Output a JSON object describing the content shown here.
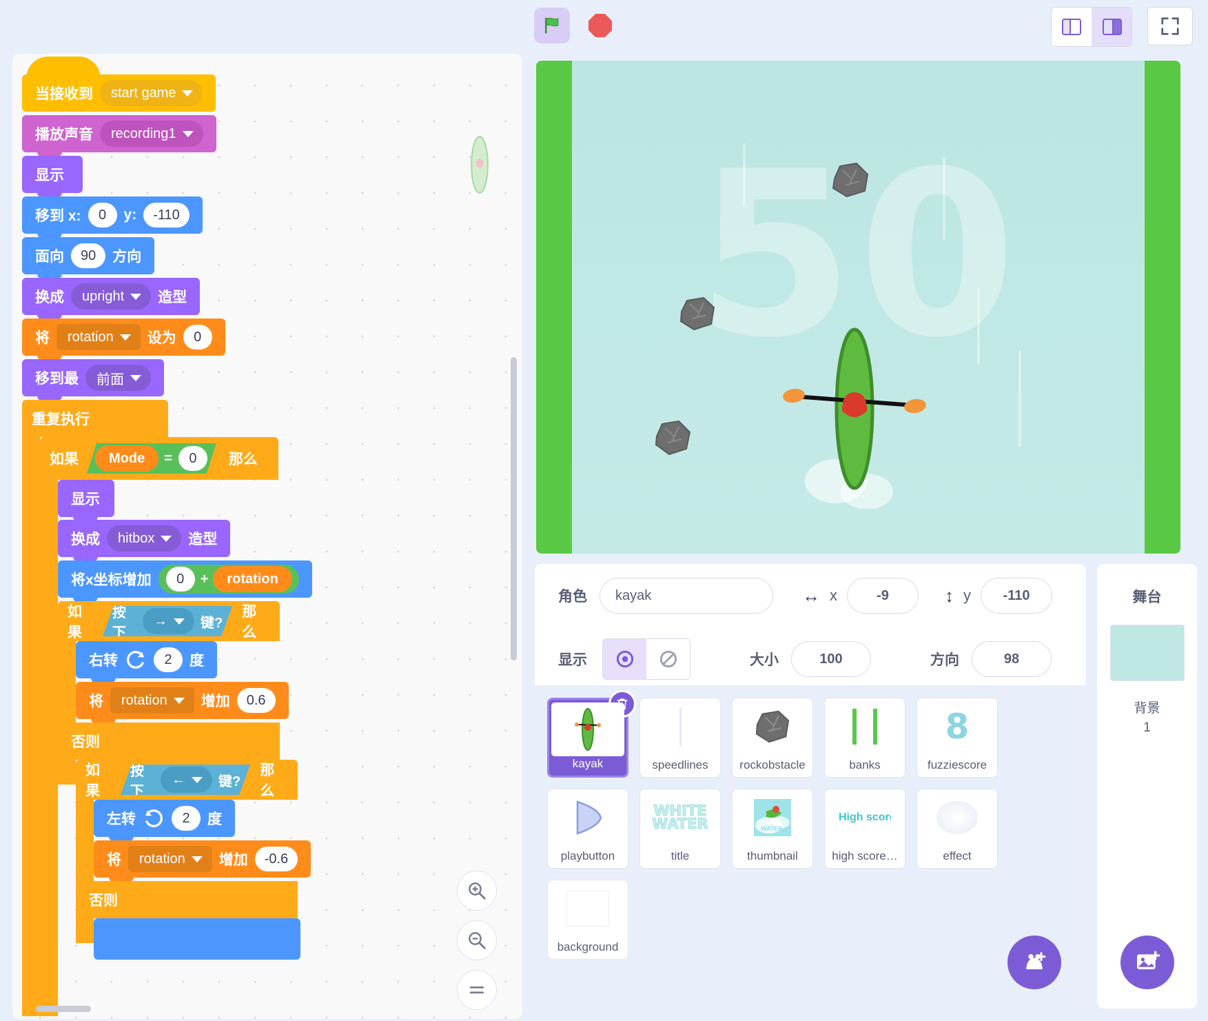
{
  "topbar": {
    "green_flag": "green-flag-icon",
    "stop": "stop-icon",
    "layout_small": "small-stage-layout-icon",
    "layout_large": "large-stage-layout-icon",
    "fullscreen": "fullscreen-icon"
  },
  "code": {
    "blocks": {
      "when_receive": "当接收到",
      "when_receive_value": "start game",
      "play_sound": "播放声音",
      "play_sound_value": "recording1",
      "show": "显示",
      "goto_xy": "移到 x:",
      "goto_x_value": "0",
      "goto_y_label": "y:",
      "goto_y_value": "-110",
      "point_dir": "面向",
      "point_dir_value": "90",
      "point_dir_suffix": "方向",
      "switch_costume": "换成",
      "switch_costume_value": "upright",
      "costume_suffix": "造型",
      "set_var": "将",
      "set_var_name": "rotation",
      "set_var_to": "设为",
      "set_var_value": "0",
      "goto_layer": "移到最",
      "goto_layer_value": "前面",
      "forever": "重复执行",
      "if": "如果",
      "then": "那么",
      "else": "否则",
      "mode_var": "Mode",
      "equals": "=",
      "mode_value": "0",
      "show2": "显示",
      "switch_costume2": "换成",
      "switch_costume2_value": "hitbox",
      "change_x": "将x坐标增加",
      "change_x_value": "0",
      "plus": "+",
      "rotation_reporter": "rotation",
      "key_pressed": "按下",
      "key_right": "→",
      "key_left": "←",
      "key_suffix": "键?",
      "turn_right": "右转",
      "turn_right_value": "2",
      "deg": "度",
      "change_var": "将",
      "change_var_name": "rotation",
      "change_var_by": "增加",
      "change_var_value": "0.6",
      "turn_left": "左转",
      "turn_left_value": "2",
      "change_var_value_neg": "-0.6"
    },
    "zoom_in": "zoom-in-icon",
    "zoom_out": "zoom-out-icon",
    "zoom_reset": "zoom-reset-icon"
  },
  "stage": {
    "score": "50"
  },
  "sprite_info": {
    "sprite_label": "角色",
    "sprite_name": "kayak",
    "x_label": "x",
    "x_value": "-9",
    "y_label": "y",
    "y_value": "-110",
    "show_label": "显示",
    "size_label": "大小",
    "size_value": "100",
    "direction_label": "方向",
    "direction_value": "98"
  },
  "sprites": [
    {
      "name": "kayak",
      "icon": "kayak-icon",
      "selected": true
    },
    {
      "name": "speedlines",
      "icon": "speedlines-icon",
      "selected": false
    },
    {
      "name": "rockobstacle",
      "icon": "rock-icon",
      "selected": false
    },
    {
      "name": "banks",
      "icon": "banks-icon",
      "selected": false
    },
    {
      "name": "fuzziescore",
      "icon": "digit-icon",
      "selected": false
    },
    {
      "name": "playbutton",
      "icon": "play-triangle-icon",
      "selected": false
    },
    {
      "name": "title",
      "icon": "white-water-title-icon",
      "selected": false
    },
    {
      "name": "thumbnail",
      "icon": "thumbnail-icon",
      "selected": false
    },
    {
      "name": "high score…",
      "icon": "high-score-icon",
      "selected": false
    },
    {
      "name": "effect",
      "icon": "effect-blob-icon",
      "selected": false
    },
    {
      "name": "background",
      "icon": "white-square-icon",
      "selected": false
    }
  ],
  "sprite_extra": {
    "fuzziescore_glyph": "8",
    "high_score_text": "High score",
    "title_text_line1": "WHITE",
    "title_text_line2": "WATER",
    "add_sprite": "add-sprite-icon",
    "delete_sprite": "delete-sprite-icon"
  },
  "stage_panel": {
    "title": "舞台",
    "backdrop_label": "背景",
    "backdrop_count": "1",
    "add_backdrop": "add-backdrop-icon"
  }
}
